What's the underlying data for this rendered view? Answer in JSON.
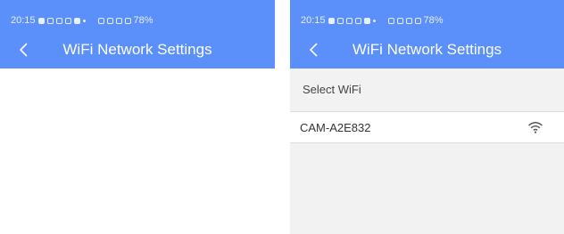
{
  "screens": [
    {
      "status_bar": {
        "time": "20:15",
        "battery": "78%"
      },
      "header": {
        "title": "WiFi Network Settings"
      }
    },
    {
      "status_bar": {
        "time": "20:15",
        "battery": "78%"
      },
      "header": {
        "title": "WiFi Network Settings"
      },
      "section_label": "Select WiFi",
      "networks": [
        {
          "ssid": "CAM-A2E832",
          "icon": "wifi-signal-icon"
        }
      ]
    }
  ],
  "colors": {
    "header": "#5b8ff9",
    "background": "#f2f2f2",
    "divider": "#dcdcdc"
  }
}
